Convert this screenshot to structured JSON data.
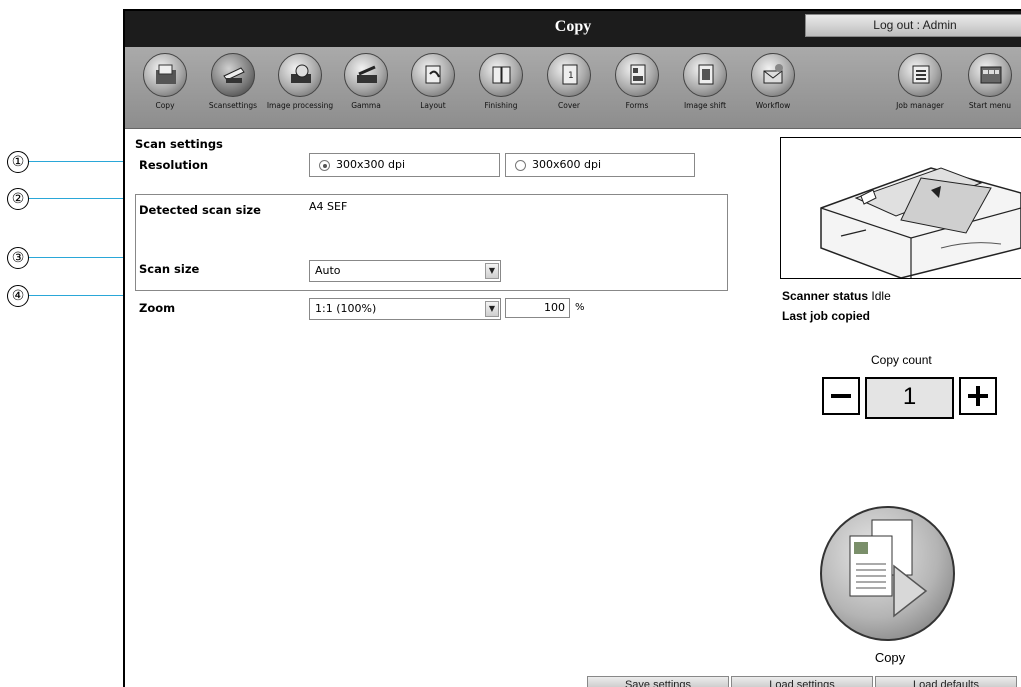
{
  "annotations": [
    "①",
    "②",
    "③",
    "④"
  ],
  "window": {
    "title": "Copy",
    "logout_label": "Log out : Admin"
  },
  "toolbar": {
    "items": [
      {
        "label": "Copy",
        "icon": "copy-icon"
      },
      {
        "label": "Scansettings",
        "icon": "scanner-icon"
      },
      {
        "label": "Image processing",
        "icon": "image-processing-icon"
      },
      {
        "label": "Gamma",
        "icon": "gamma-icon"
      },
      {
        "label": "Layout",
        "icon": "layout-icon"
      },
      {
        "label": "Finishing",
        "icon": "finishing-icon"
      },
      {
        "label": "Cover",
        "icon": "cover-icon"
      },
      {
        "label": "Forms",
        "icon": "forms-icon"
      },
      {
        "label": "Image shift",
        "icon": "image-shift-icon"
      },
      {
        "label": "Workflow",
        "icon": "workflow-icon"
      },
      {
        "label": "Job manager",
        "icon": "job-manager-icon"
      },
      {
        "label": "Start menu",
        "icon": "start-menu-icon"
      }
    ]
  },
  "scan_settings": {
    "heading": "Scan settings",
    "resolution": {
      "label": "Resolution",
      "options": [
        "300x300 dpi",
        "300x600 dpi"
      ],
      "selected": "300x300 dpi"
    },
    "detected_scan_size": {
      "label": "Detected scan size",
      "value": "A4 SEF"
    },
    "scan_size": {
      "label": "Scan size",
      "value": "Auto"
    },
    "zoom": {
      "label": "Zoom",
      "preset": "1:1 (100%)",
      "value": "100",
      "unit": "%"
    }
  },
  "status": {
    "scanner_status_label": "Scanner status",
    "scanner_status_value": "Idle",
    "last_job_label": "Last job copied"
  },
  "copy_count": {
    "label": "Copy count",
    "value": "1",
    "minus": "−",
    "plus": "+"
  },
  "copy_button": {
    "label": "Copy"
  },
  "bottom_buttons": {
    "save": "Save settings",
    "load": "Load settings",
    "defaults": "Load defaults"
  },
  "colors": {
    "titlebar": "#1c1c1c",
    "toolbar": "#9a9a9a",
    "annotation_line": "#2aa7d8"
  }
}
